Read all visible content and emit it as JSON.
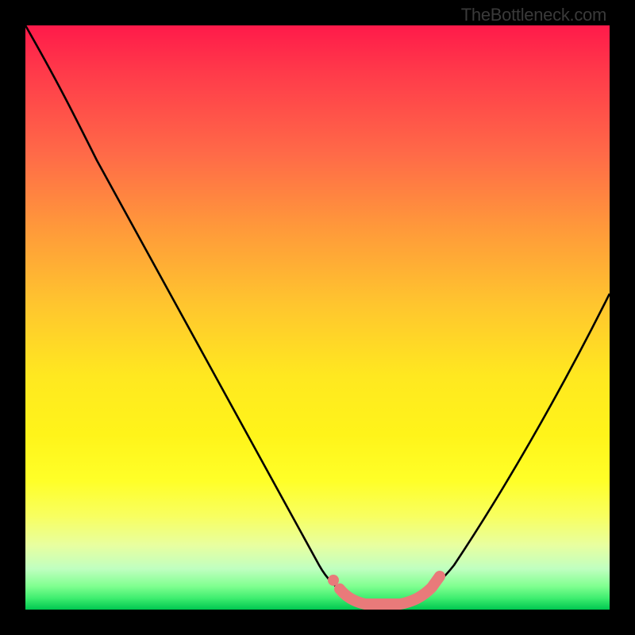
{
  "watermark": "TheBottleneck.com",
  "chart_data": {
    "type": "line",
    "title": "",
    "xlabel": "",
    "ylabel": "",
    "x": [
      0.0,
      0.05,
      0.1,
      0.15,
      0.2,
      0.25,
      0.3,
      0.35,
      0.4,
      0.45,
      0.5,
      0.54,
      0.58,
      0.62,
      0.66,
      0.7,
      0.75,
      0.8,
      0.85,
      0.9,
      0.95,
      1.0
    ],
    "values": [
      100,
      91,
      82,
      73,
      64,
      55,
      46,
      37,
      28,
      19,
      10,
      3,
      1,
      0,
      0,
      1,
      4,
      11,
      21,
      33,
      46,
      60
    ],
    "ylim": [
      0,
      100
    ],
    "xlim": [
      0,
      1
    ],
    "flat_highlight": {
      "x_start": 0.54,
      "x_end": 0.7,
      "y": 0,
      "note": "thick coral segment near valley floor"
    },
    "colors": {
      "curve": "#000000",
      "highlight": "#e97a7a",
      "background_top": "#ff1a4a",
      "background_bottom": "#00c850"
    }
  }
}
